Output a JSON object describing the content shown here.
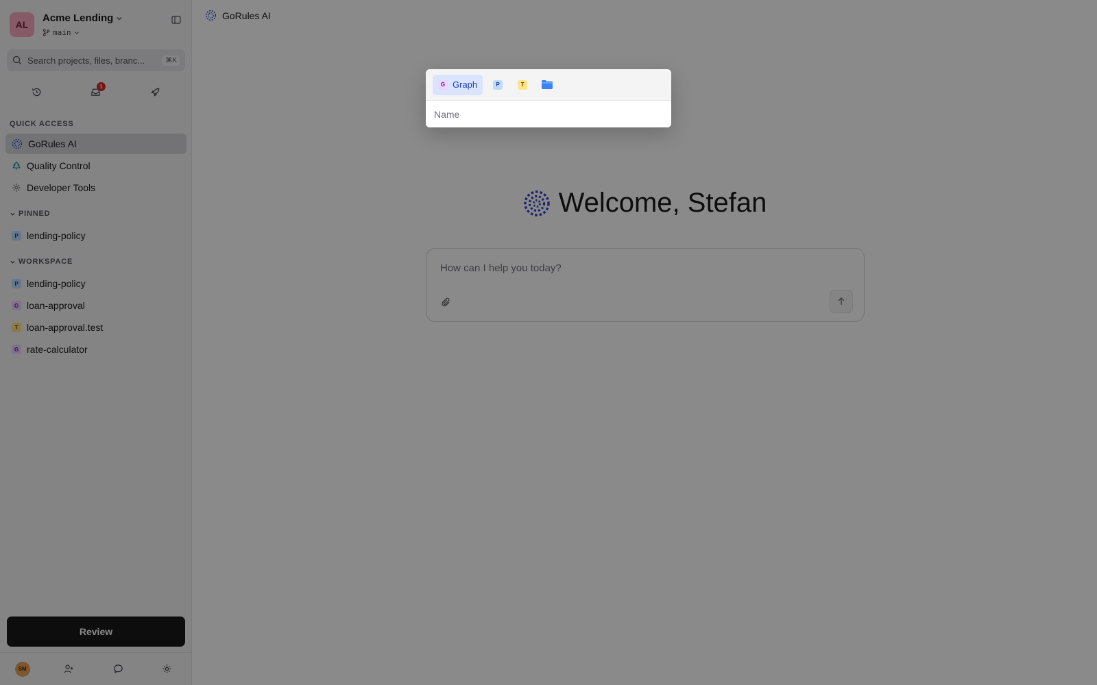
{
  "workspace": {
    "avatar_initials": "AL",
    "name": "Acme Lending",
    "branch": "main",
    "avatar_color": "#f7a8bf"
  },
  "search": {
    "placeholder": "Search projects, files, branc...",
    "shortcut": "⌘K"
  },
  "toolbar": {
    "notification_count": "1"
  },
  "quick_access": {
    "label": "QUICK ACCESS",
    "items": [
      {
        "label": "GoRules AI",
        "icon": "ai-spark-icon",
        "active": true
      },
      {
        "label": "Quality Control",
        "icon": "quality-tree-icon"
      },
      {
        "label": "Developer Tools",
        "icon": "developer-tools-icon"
      }
    ]
  },
  "pinned": {
    "label": "PINNED",
    "items": [
      {
        "label": "lending-policy",
        "badge": "P"
      }
    ]
  },
  "workspace_section": {
    "label": "WORKSPACE",
    "items": [
      {
        "label": "lending-policy",
        "badge": "P"
      },
      {
        "label": "loan-approval",
        "badge": "G"
      },
      {
        "label": "loan-approval.test",
        "badge": "T"
      },
      {
        "label": "rate-calculator",
        "badge": "G"
      }
    ]
  },
  "review_label": "Review",
  "footer": {
    "user_initials": "SM"
  },
  "main": {
    "page_title": "GoRules AI",
    "welcome": "Welcome, Stefan",
    "chat_placeholder": "How can I help you today?",
    "accent_color": "#3344cc"
  },
  "popover": {
    "tabs": [
      {
        "badge": "G",
        "label": "Graph",
        "active": true
      },
      {
        "badge": "P"
      },
      {
        "badge": "T"
      },
      {
        "icon": "folder-icon"
      }
    ],
    "name_placeholder": "Name"
  }
}
